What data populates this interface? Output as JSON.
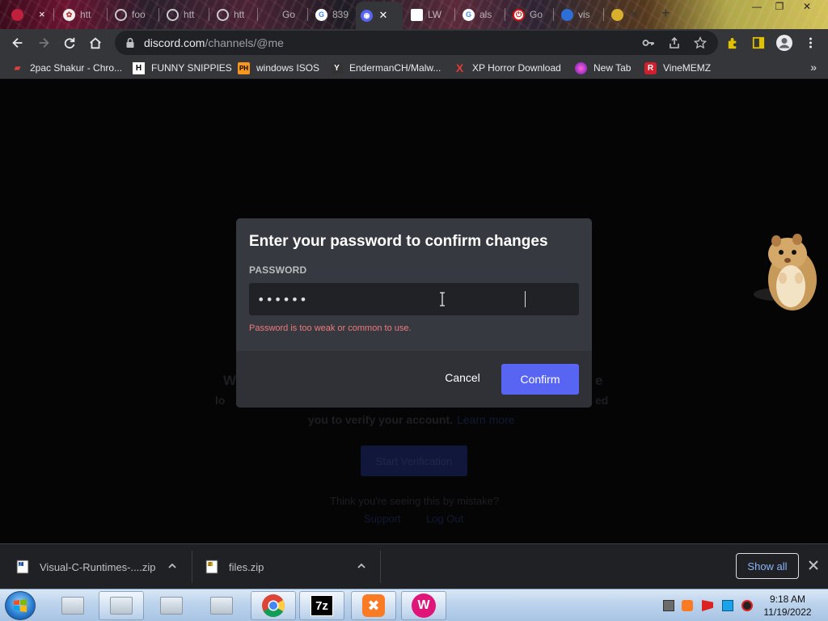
{
  "browser": {
    "tabs": [
      {
        "title": "",
        "icon": "red-app-icon"
      },
      {
        "title": "htt",
        "icon": "flower-icon"
      },
      {
        "title": "foo",
        "icon": "spiral-icon"
      },
      {
        "title": "htt",
        "icon": "spiral-icon"
      },
      {
        "title": "htt",
        "icon": "spiral-icon"
      },
      {
        "title": "Go",
        "icon": "blank-icon"
      },
      {
        "title": "839",
        "icon": "google-icon"
      },
      {
        "title": "",
        "icon": "discord-icon",
        "active": true
      },
      {
        "title": "LW",
        "icon": "white-square-icon"
      },
      {
        "title": "als",
        "icon": "google-icon"
      },
      {
        "title": "Go",
        "icon": "red-power-icon"
      },
      {
        "title": "vis",
        "icon": "blue-icon"
      },
      {
        "title": "",
        "icon": "yellow-icon"
      }
    ],
    "url_host": "discord.com",
    "url_path": "/channels/@me",
    "bookmarks": [
      {
        "label": "2pac Shakur - Chro...",
        "icon": "red-tag-icon"
      },
      {
        "label": "FUNNY SNIPPIES",
        "icon": "h-letter-icon",
        "letter": "H"
      },
      {
        "label": "windows ISOS",
        "icon": "ph-icon",
        "letter": "PH"
      },
      {
        "label": "EndermanCH/Malw...",
        "icon": "yp-icon",
        "letter": "Y"
      },
      {
        "label": "XP Horror Download",
        "icon": "x-letter-icon",
        "letter": "X"
      },
      {
        "label": "New Tab",
        "icon": "globe-icon"
      },
      {
        "label": "VineMEMZ",
        "icon": "r-letter-icon",
        "letter": "R"
      }
    ]
  },
  "background": {
    "line1_left": "W",
    "line1_right": "e",
    "line2_left": "lo",
    "line2_right": "ed",
    "line3": "you to verify your account.",
    "line3_link": "Learn more",
    "button": "Start Verification",
    "line4": "Think you're seeing this by mistake?",
    "link_a": "Support",
    "link_b": "Log Out"
  },
  "modal": {
    "title": "Enter your password to confirm changes",
    "field_label": "PASSWORD",
    "password_value": "••••••",
    "error": "Password is too weak or common to use.",
    "cancel": "Cancel",
    "confirm": "Confirm"
  },
  "downloads": {
    "items": [
      {
        "name": "Visual-C-Runtimes-....zip"
      },
      {
        "name": "files.zip"
      }
    ],
    "show_all": "Show all"
  },
  "taskbar": {
    "time": "9:18 AM",
    "date": "11/19/2022"
  },
  "colors": {
    "accent": "#5865f2",
    "error": "#f07a7d",
    "modal_bg": "#36393f",
    "footer_bg": "#2f3136"
  }
}
